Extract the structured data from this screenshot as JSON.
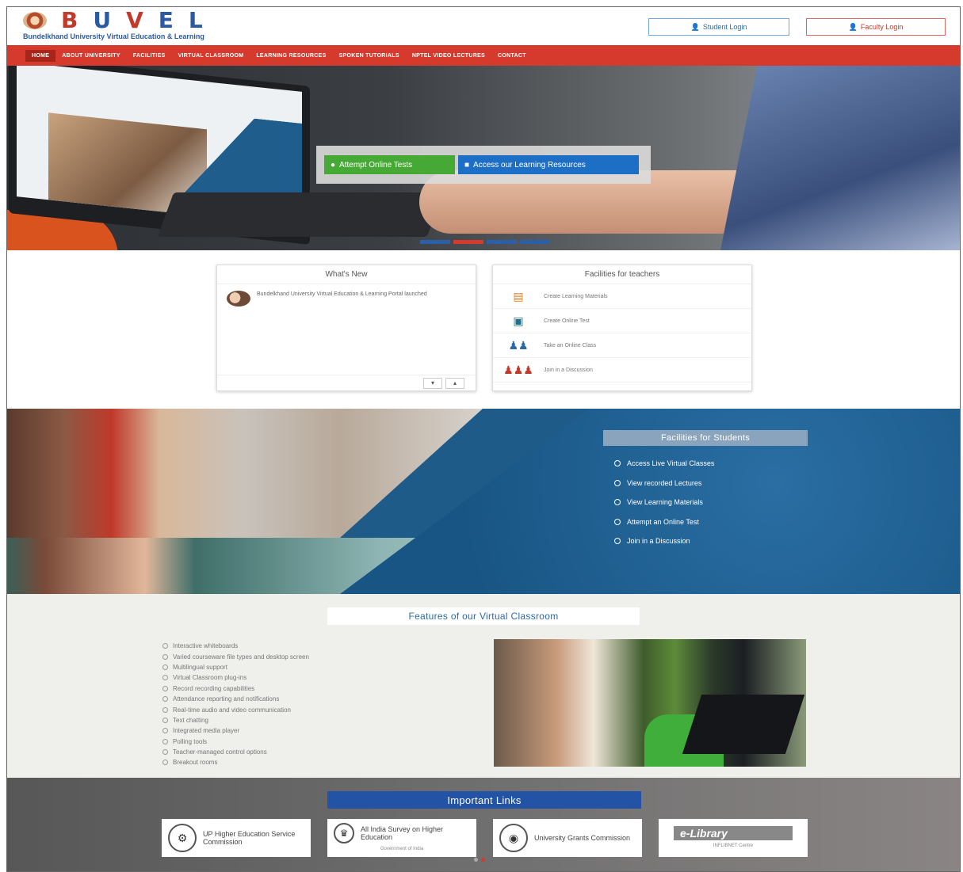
{
  "header": {
    "logo_letters": [
      "B",
      "U",
      "V",
      "E",
      "L"
    ],
    "logo_colors": [
      "#c0392b",
      "#2c5aa0",
      "#c0392b",
      "#2c5aa0",
      "#2c5aa0"
    ],
    "logo_subtitle": "Bundelkhand University Virtual Education & Learning",
    "student_login": "Student Login",
    "faculty_login": "Faculty Login"
  },
  "nav": {
    "items": [
      "HOME",
      "ABOUT UNIVERSITY",
      "FACILITIES",
      "VIRTUAL CLASSROOM",
      "LEARNING RESOURCES",
      "SPOKEN TUTORIALS",
      "NPTEL VIDEO LECTURES",
      "CONTACT"
    ]
  },
  "hero": {
    "cta_tests": "Attempt Online Tests",
    "cta_resources": "Access our Learning Resources"
  },
  "whats_new": {
    "title": "What's New",
    "items": [
      "Bundelkhand University Virtual Education & Learning Portal launched"
    ],
    "btn_down": "▾",
    "btn_up": "▴"
  },
  "teachers": {
    "title": "Facilities for teachers",
    "items": [
      "Create Learning Materials",
      "Create Online Test",
      "Take an Online Class",
      "Join in a Discussion"
    ]
  },
  "students": {
    "title": "Facilities for Students",
    "items": [
      "Access Live Virtual Classes",
      "View recorded Lectures",
      "View Learning Materials",
      "Attempt an Online Test",
      "Join in a Discussion"
    ]
  },
  "features": {
    "title": "Features of our Virtual Classroom",
    "items": [
      "Interactive whiteboards",
      "Varied courseware file types and desktop screen",
      "Multilingual support",
      "Virtual Classroom plug-ins",
      "Record recording capabilities",
      "Attendance reporting and notifications",
      "Real-time audio and video communication",
      "Text chatting",
      "Integrated media player",
      "Polling tools",
      "Teacher-managed control options",
      "Breakout rooms"
    ]
  },
  "links": {
    "title": "Important Links",
    "cards": [
      {
        "name": "UP Higher Education Service Commission",
        "sub": ""
      },
      {
        "name": "All India Survey on Higher Education",
        "sub": "Government of India"
      },
      {
        "name": "University Grants Commission",
        "sub": ""
      },
      {
        "name": "e-Library",
        "sub": "INFLIBNET Centre"
      }
    ]
  },
  "colors": {
    "nav_red": "#d63a2c",
    "brand_blue": "#2253a4",
    "cta_green": "#46a935",
    "cta_blue": "#1c6fc4"
  }
}
